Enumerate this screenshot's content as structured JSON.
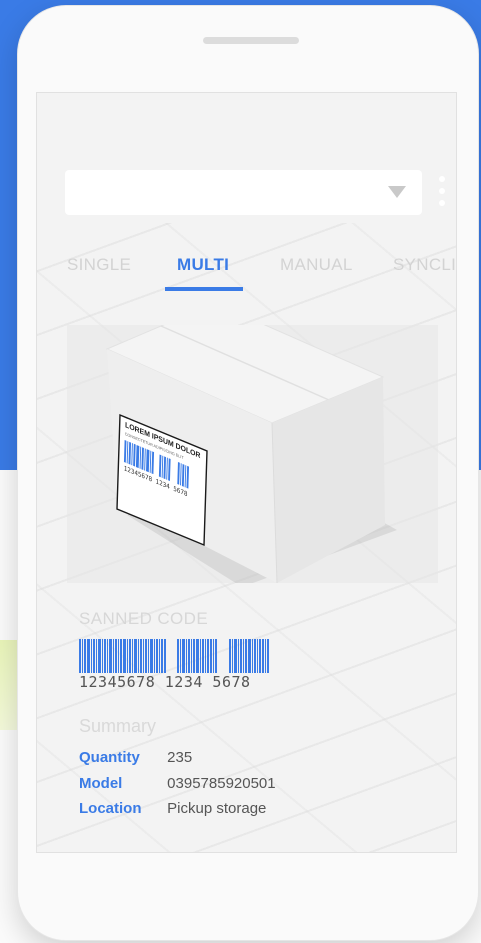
{
  "dropdown": {
    "value": ""
  },
  "tabs": [
    {
      "label": "SINGLE",
      "active": false
    },
    {
      "label": "MULTI",
      "active": true
    },
    {
      "label": "MANUAL",
      "active": false
    },
    {
      "label": "SYNCLIS",
      "active": false
    }
  ],
  "label_card": {
    "title": "LOREM IPSUM DOLOR",
    "subtitle": "CONSECTETUR ADIPISCING ELIT",
    "digits": "12345678 1234 5678"
  },
  "scanned": {
    "title": "SANNED CODE",
    "digits": "12345678 1234 5678"
  },
  "summary": {
    "title": "Summary",
    "rows": [
      {
        "key": "Quantity",
        "value": "235"
      },
      {
        "key": "Model",
        "value": "0395785920501"
      },
      {
        "key": "Location",
        "value": "Pickup storage"
      }
    ]
  },
  "colors": {
    "accent": "#3a7be6",
    "background_blue": "#3a7be6",
    "muted_text": "#d3d3d3"
  }
}
